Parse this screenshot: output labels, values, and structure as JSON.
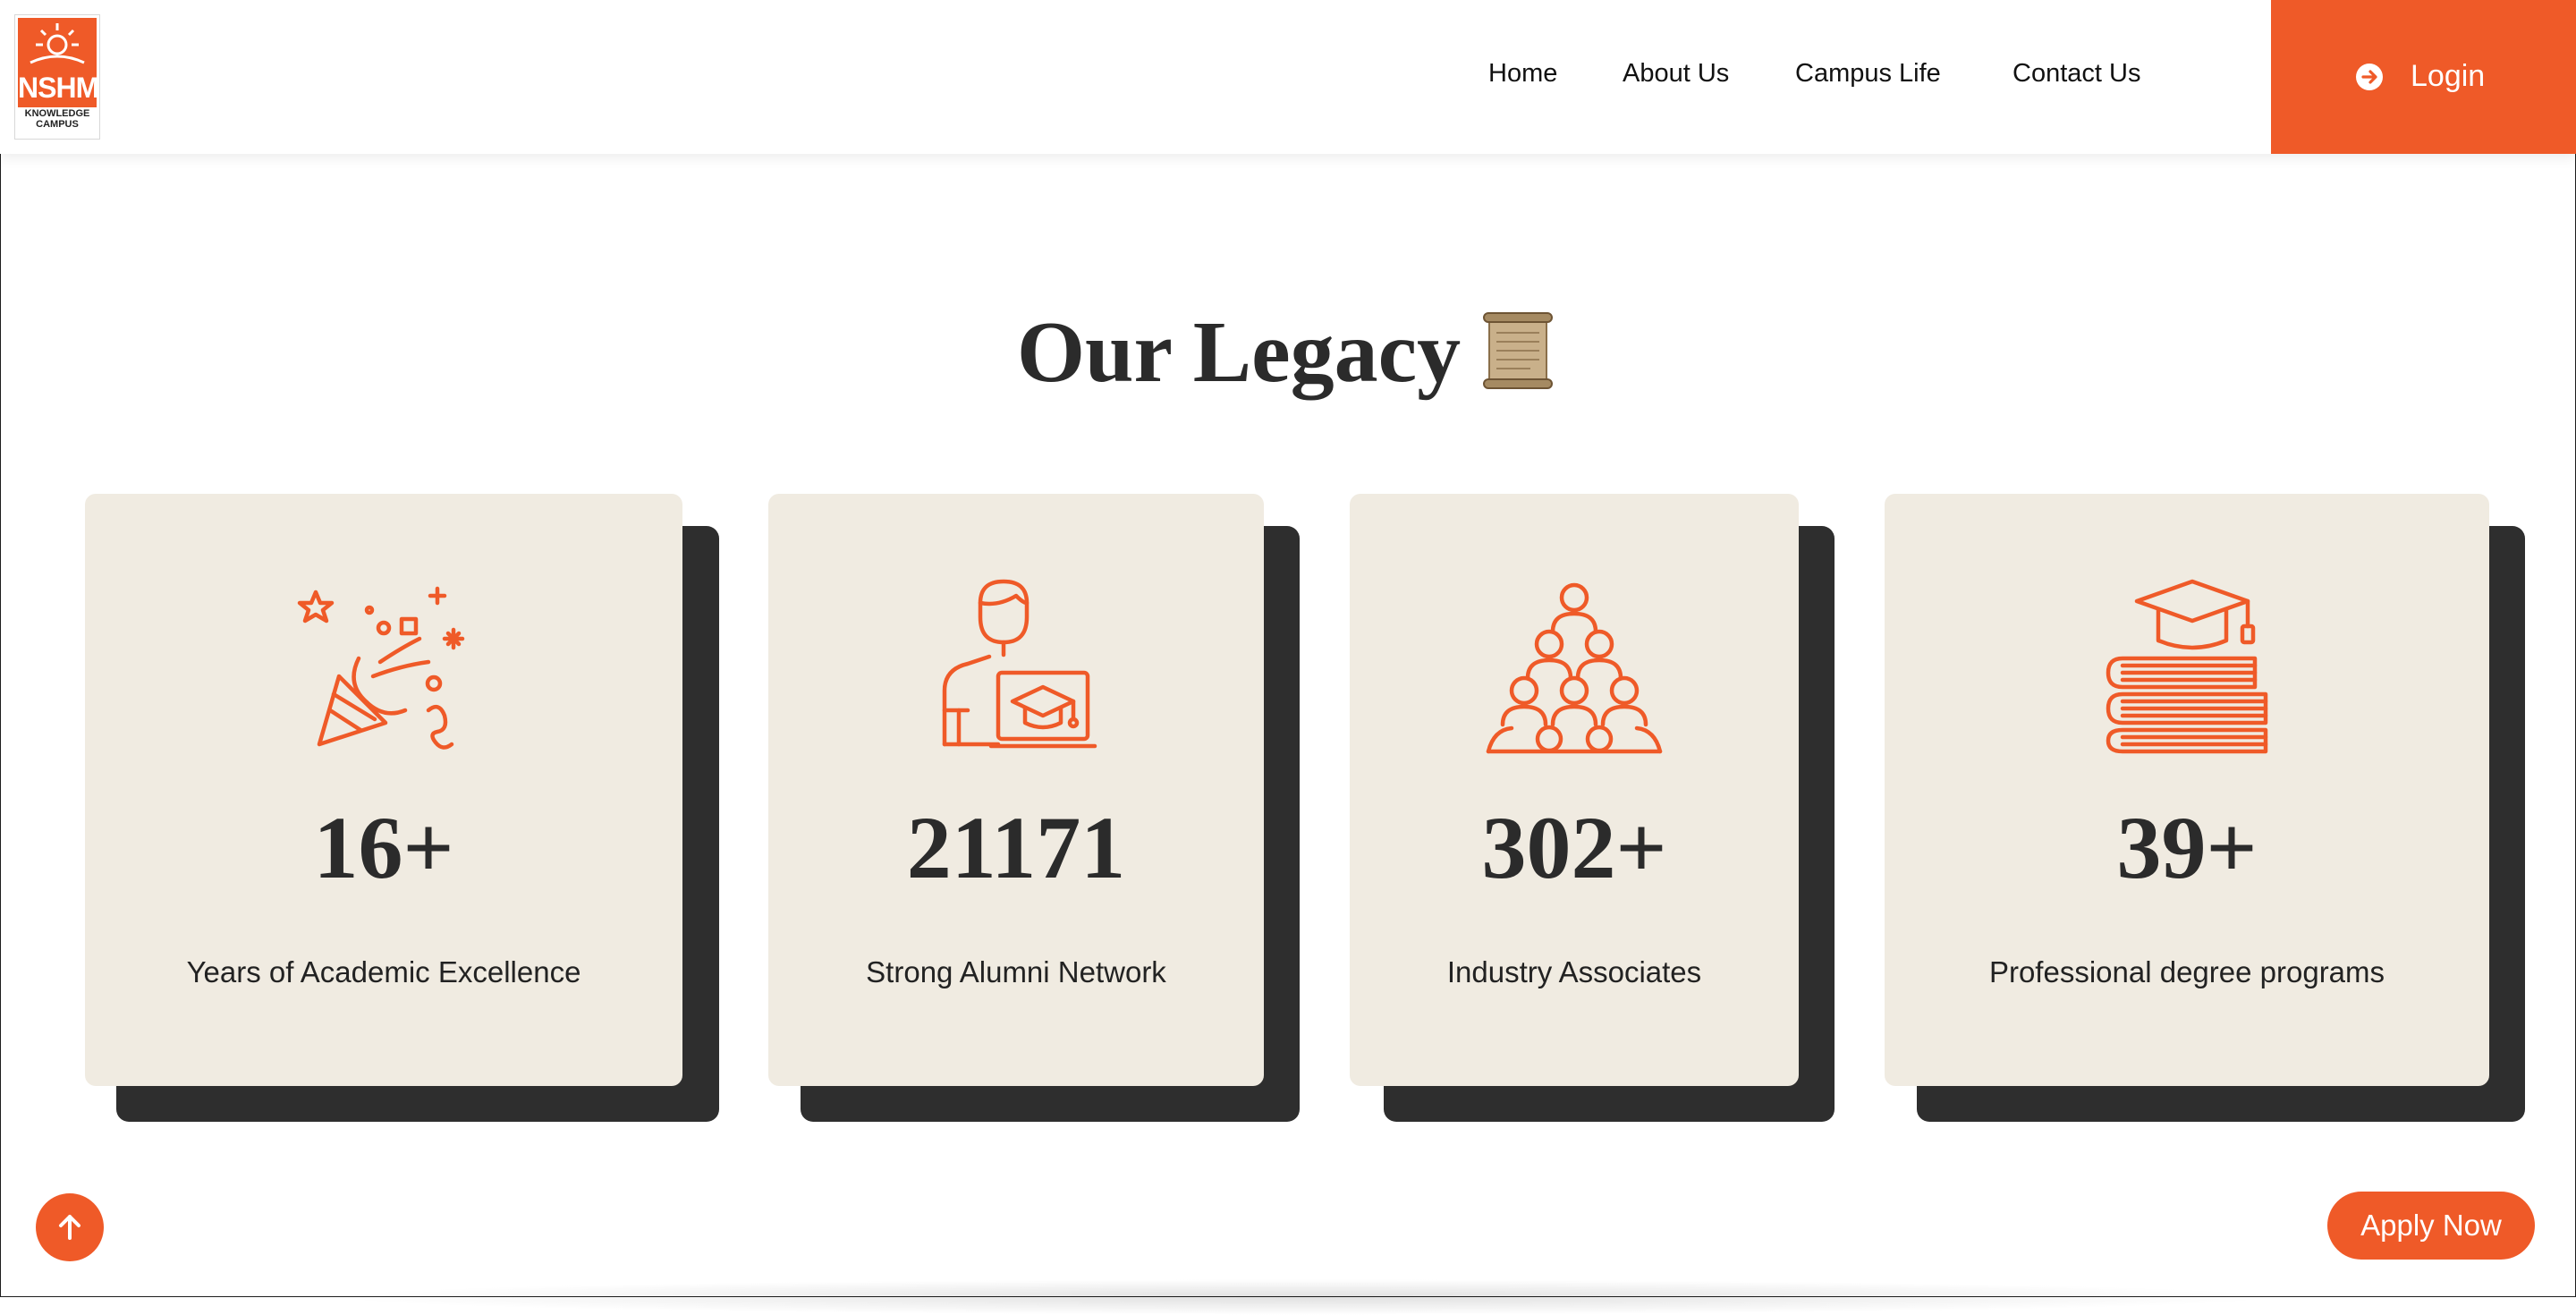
{
  "logo": {
    "name": "NSHM",
    "subtitle": "KNOWLEDGE CAMPUS"
  },
  "nav": {
    "items": [
      "Home",
      "About Us",
      "Campus Life",
      "Contact Us"
    ],
    "login_label": "Login"
  },
  "section": {
    "title": "Our Legacy"
  },
  "stats": [
    {
      "value": "16+",
      "label": "Years of Academic Excellence",
      "icon": "party-popper-icon"
    },
    {
      "value": "21171",
      "label": "Strong Alumni Network",
      "icon": "graduate-laptop-icon"
    },
    {
      "value": "302+",
      "label": "Industry Associates",
      "icon": "people-pyramid-icon"
    },
    {
      "value": "39+",
      "label": "Professional degree programs",
      "icon": "books-graduation-cap-icon"
    }
  ],
  "floating": {
    "apply_label": "Apply Now",
    "back_to_top_icon": "arrow-up-icon"
  },
  "colors": {
    "accent": "#ef5a28",
    "card_bg": "#f0ebe1",
    "card_shadow": "#2e2e2e",
    "text_dark": "#2b2b2b"
  }
}
